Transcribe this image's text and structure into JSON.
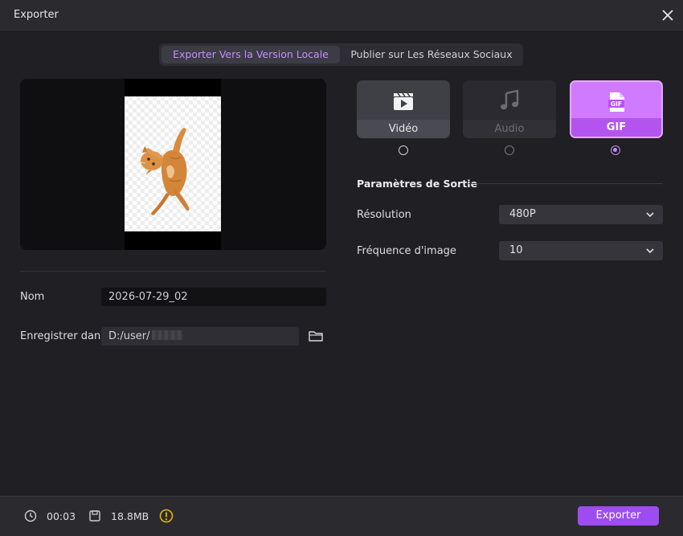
{
  "window": {
    "title": "Exporter"
  },
  "tabs": [
    {
      "label": "Exporter Vers la Version Locale",
      "active": true
    },
    {
      "label": "Publier sur Les Réseaux Sociaux",
      "active": false
    }
  ],
  "form": {
    "name_label": "Nom",
    "name_value": "2026-07-29_02",
    "save_label": "Enregistrer dans",
    "save_path": "D:/user/"
  },
  "formats": [
    {
      "label": "Vidéo",
      "icon": "video-clapper-icon",
      "selected": false,
      "enabled": true
    },
    {
      "label": "Audio",
      "icon": "music-note-icon",
      "selected": false,
      "enabled": false
    },
    {
      "label": "GIF",
      "icon": "gif-file-icon",
      "selected": true,
      "enabled": true
    }
  ],
  "output": {
    "title": "Paramètres de Sortie",
    "resolution_label": "Résolution",
    "resolution_value": "480P",
    "framerate_label": "Fréquence d'image",
    "framerate_value": "10"
  },
  "footer": {
    "duration": "00:03",
    "size": "18.8MB",
    "export_label": "Exporter"
  },
  "colors": {
    "accent": "#9e4cf2",
    "accent_light": "#c78cff",
    "background": "#1f1f24",
    "warning": "#e6b800"
  }
}
